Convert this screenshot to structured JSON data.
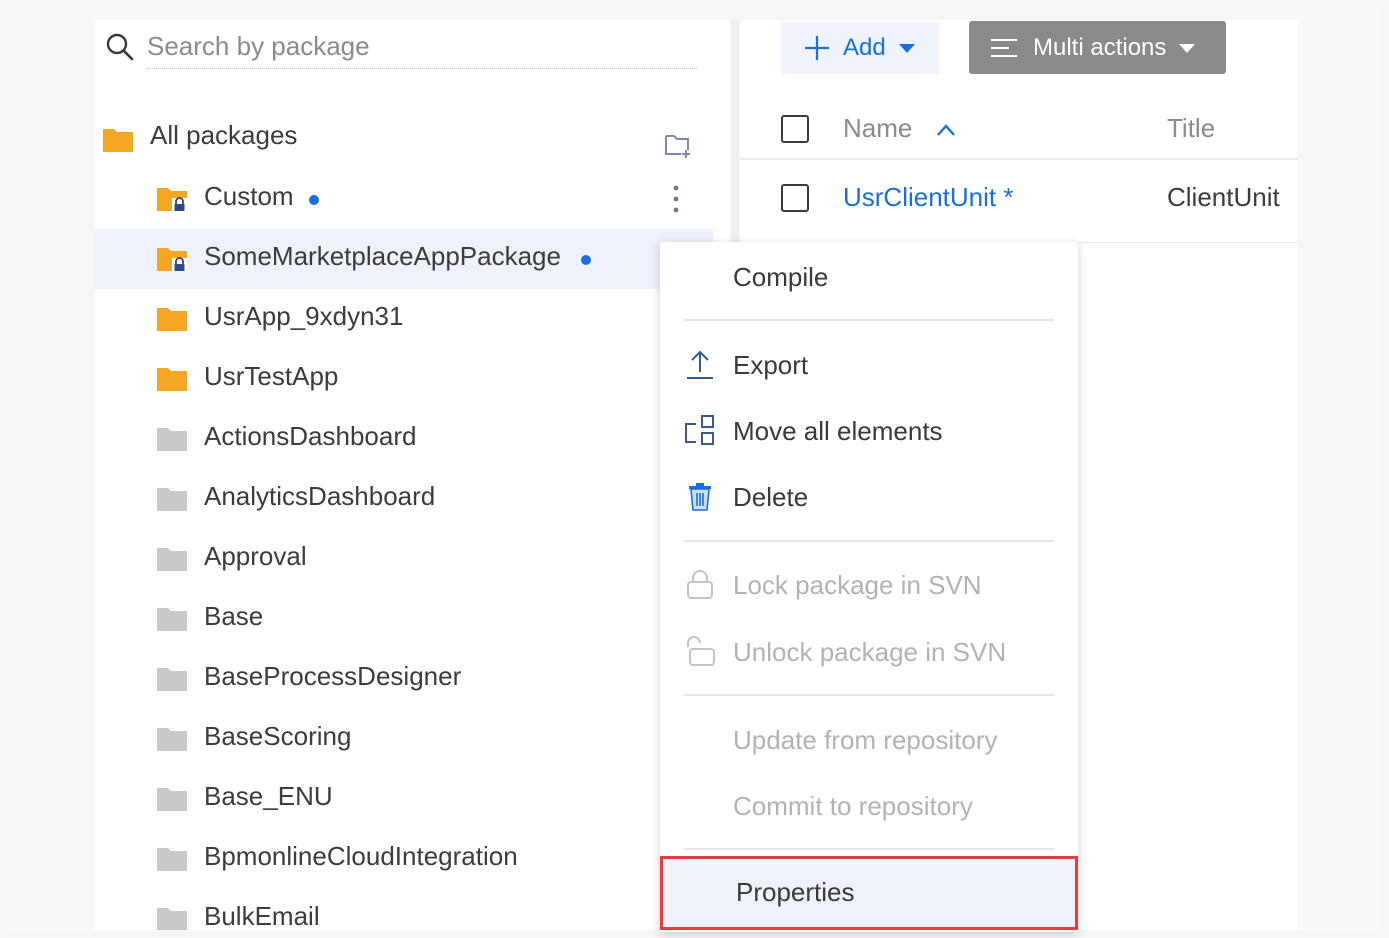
{
  "search": {
    "placeholder": "Search by package"
  },
  "tree": {
    "root_label": "All packages",
    "items": [
      {
        "label": "Custom",
        "folder": "orange-locked",
        "dot": true
      },
      {
        "label": "SomeMarketplaceAppPackage",
        "folder": "orange-locked",
        "dot": true,
        "selected": true
      },
      {
        "label": "UsrApp_9xdyn31",
        "folder": "orange"
      },
      {
        "label": "UsrTestApp",
        "folder": "orange"
      },
      {
        "label": "ActionsDashboard",
        "folder": "gray"
      },
      {
        "label": "AnalyticsDashboard",
        "folder": "gray"
      },
      {
        "label": "Approval",
        "folder": "gray"
      },
      {
        "label": "Base",
        "folder": "gray"
      },
      {
        "label": "BaseProcessDesigner",
        "folder": "gray"
      },
      {
        "label": "BaseScoring",
        "folder": "gray"
      },
      {
        "label": "Base_ENU",
        "folder": "gray"
      },
      {
        "label": "BpmonlineCloudIntegration",
        "folder": "gray"
      },
      {
        "label": "BulkEmail",
        "folder": "gray"
      }
    ]
  },
  "toolbar": {
    "add_label": "Add",
    "multi_label": "Multi actions"
  },
  "table": {
    "columns": {
      "name": "Name",
      "title": "Title"
    },
    "rows": [
      {
        "name": "UsrClientUnit *",
        "title": "ClientUnit"
      }
    ]
  },
  "context_menu": {
    "items": [
      {
        "label": "Compile",
        "enabled": true
      },
      {
        "label": "Export",
        "enabled": true,
        "icon": "export-icon"
      },
      {
        "label": "Move all elements",
        "enabled": true,
        "icon": "move-elements-icon"
      },
      {
        "label": "Delete",
        "enabled": true,
        "icon": "trash-icon"
      },
      {
        "label": "Lock package in SVN",
        "enabled": false,
        "icon": "lock-icon"
      },
      {
        "label": "Unlock package in SVN",
        "enabled": false,
        "icon": "unlock-icon"
      },
      {
        "label": "Update from repository",
        "enabled": false
      },
      {
        "label": "Commit to repository",
        "enabled": false
      },
      {
        "label": "Properties",
        "enabled": true,
        "highlighted": true
      }
    ]
  },
  "colors": {
    "accent": "#1a6fe0",
    "folder_orange": "#f5a623",
    "folder_gray": "#c9c9c9",
    "highlight_border": "#e63b3f",
    "selected_bg": "#edf2fb"
  }
}
